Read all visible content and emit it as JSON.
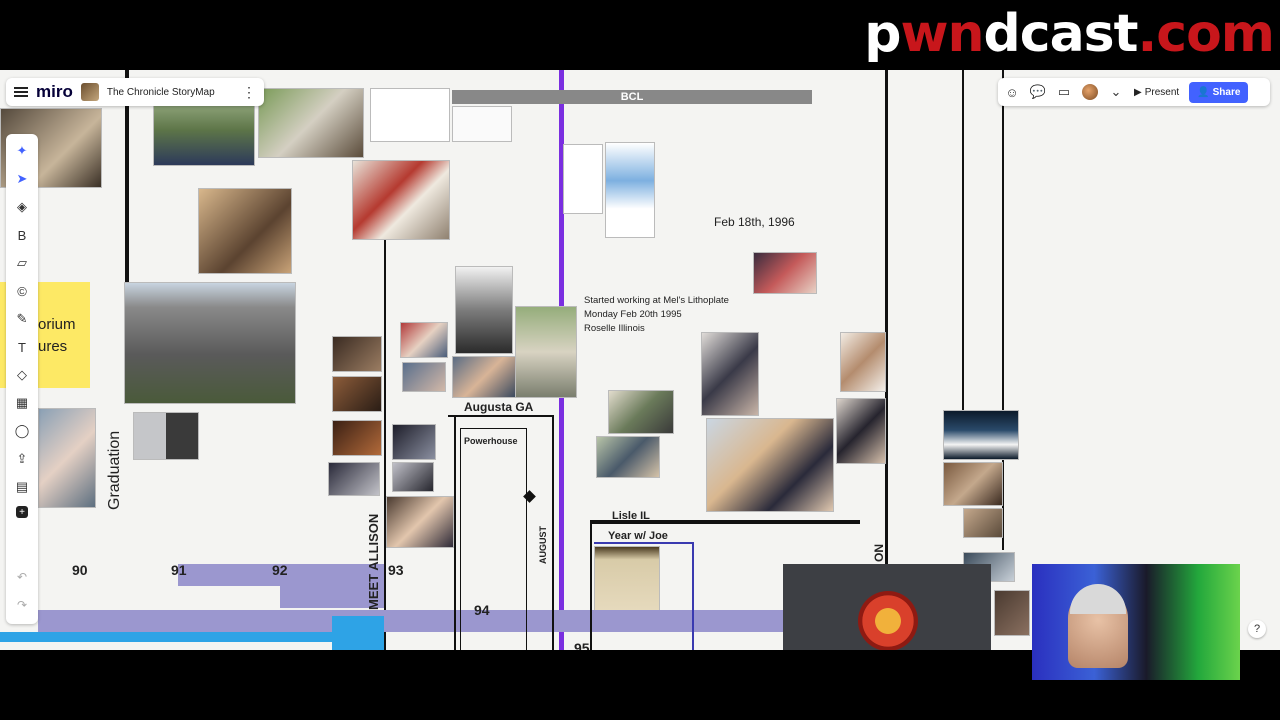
{
  "overlay": {
    "logo_prefix": "p",
    "logo_mid": "wn",
    "logo_suffix": "dcast",
    "logo_tld": ".com"
  },
  "miro": {
    "app_name": "miro",
    "board_title": "The Chronicle StoryMap",
    "present_label": "Present",
    "share_label": "Share",
    "help_label": "?"
  },
  "board": {
    "bcl_label": "BCL",
    "sticky_line1": "orium",
    "sticky_line2": "ures",
    "graduation": "Graduation",
    "meet_allison": "MEET ALLISON",
    "augusta": "Augusta GA",
    "powerhouse": "Powerhouse",
    "august": "AUGUST",
    "lisle": "Lisle IL",
    "year_joe": "Year w/ Joe",
    "feb_date": "Feb 18th, 1996",
    "mels_line1": "Started working at Mel's Lithoplate",
    "mels_line2": "Monday Feb 20th 1995",
    "mels_line3": "Roselle Illinois",
    "partial_on": "ON",
    "years": [
      "90",
      "91",
      "92",
      "93",
      "94",
      "95"
    ]
  },
  "colors": {
    "accent": "#4262ff",
    "purple_band": "#9b97cf",
    "sticky": "#fde965",
    "divider_purple": "#7a2ee0"
  }
}
